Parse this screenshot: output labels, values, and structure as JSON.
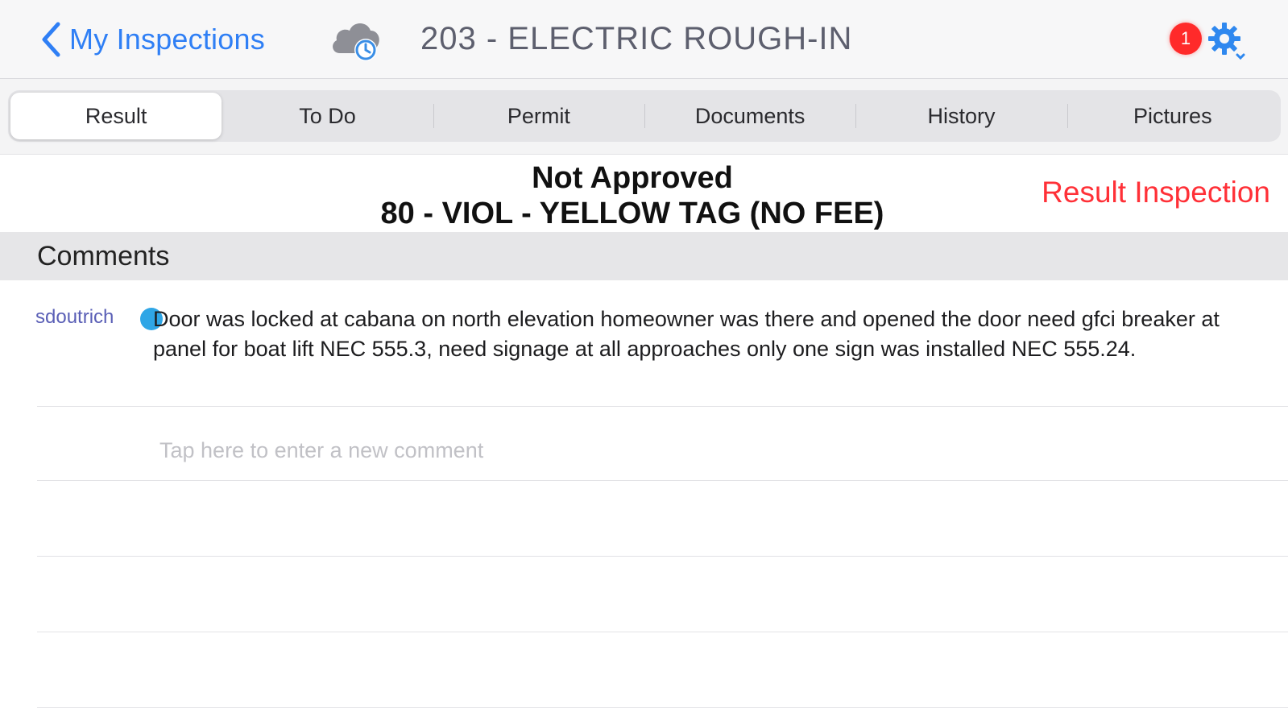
{
  "navbar": {
    "back_label": "My Inspections",
    "title": "203 - ELECTRIC ROUGH-IN",
    "badge_count": "1",
    "icons": [
      "chevron-left-icon",
      "cloud-clock-icon",
      "gear-icon"
    ],
    "colors": {
      "accent": "#2f7ff5",
      "badge": "#ff2a2a"
    }
  },
  "tabs": [
    {
      "label": "Result",
      "active": true
    },
    {
      "label": "To Do",
      "active": false
    },
    {
      "label": "Permit",
      "active": false
    },
    {
      "label": "Documents",
      "active": false
    },
    {
      "label": "History",
      "active": false
    },
    {
      "label": "Pictures",
      "active": false
    }
  ],
  "status": {
    "result": "Not Approved",
    "code": "80 - VIOL - YELLOW TAG (NO FEE)",
    "action_label": "Result Inspection",
    "action_color": "#ff3037"
  },
  "comments": {
    "header": "Comments",
    "items": [
      {
        "author": "sdoutrich",
        "text": "Door was locked at cabana on north elevation homeowner was there and opened the door need gfci breaker at panel for boat lift NEC 555.3, need signage at all approaches only one sign was installed NEC 555.24."
      }
    ],
    "new_placeholder": "Tap here to enter a new comment"
  }
}
